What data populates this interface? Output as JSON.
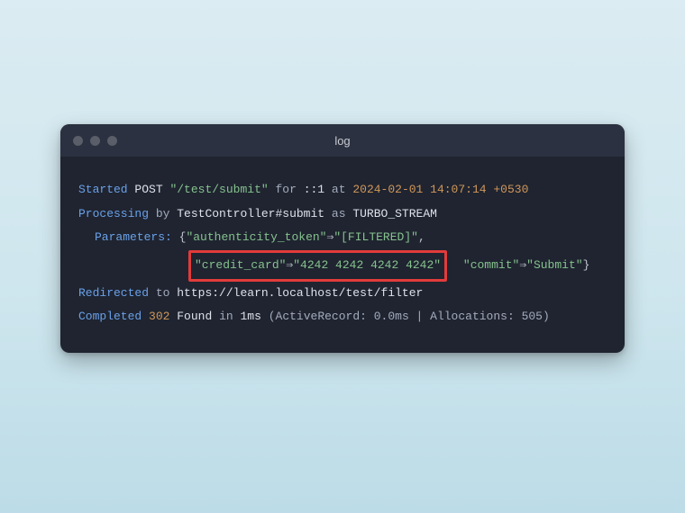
{
  "window": {
    "title": "log"
  },
  "log": {
    "line1": {
      "started": "Started",
      "method": "POST",
      "path": "\"/test/submit\"",
      "for": "for",
      "ip": "::1",
      "at": "at",
      "timestamp": "2024-02-01 14:07:14 +0530"
    },
    "line2": {
      "processing": "Processing",
      "by": "by",
      "controller": "TestController#submit",
      "as": "as",
      "format": "TURBO_STREAM"
    },
    "line3": {
      "label": "Parameters:",
      "open": "{",
      "k1": "\"authenticity_token\"",
      "arrow": "⇒",
      "v1": "\"[FILTERED]\"",
      "comma": ","
    },
    "line4": {
      "k2": "\"credit_card\"",
      "arrow": "⇒",
      "v2": "\"4242 4242 4242 4242\"",
      "k3": "\"commit\"",
      "arrow2": "⇒",
      "v3": "\"Submit\"",
      "close": "}"
    },
    "line5": {
      "redirected": "Redirected",
      "to": "to",
      "url": "https://learn.localhost/test/filter"
    },
    "line6": {
      "completed": "Completed",
      "status": "302",
      "found": "Found",
      "in": "in",
      "time": "1ms",
      "details": "(ActiveRecord: 0.0ms | Allocations: 505)"
    }
  }
}
